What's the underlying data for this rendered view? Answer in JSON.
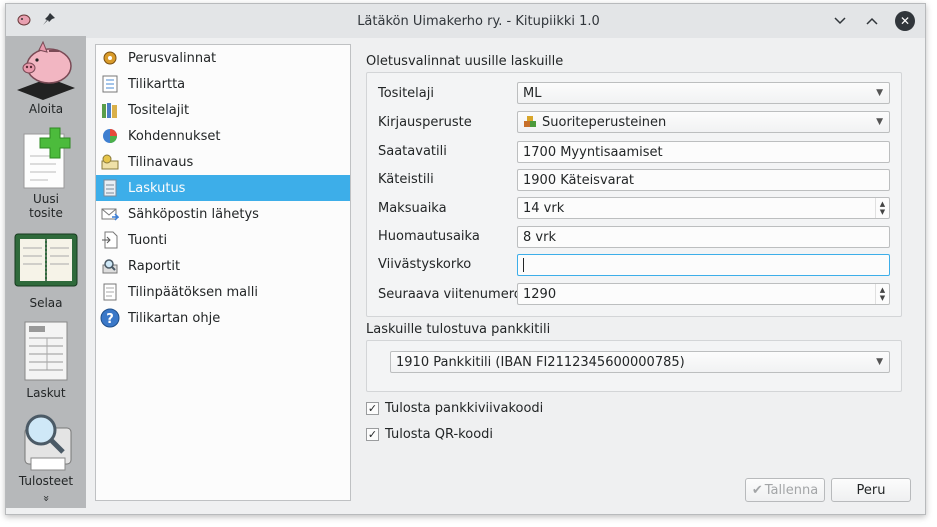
{
  "window": {
    "title": "Lätäkön Uimakerho ry. - Kitupiikki 1.0",
    "icons": [
      "app-piggy-icon",
      "pin-icon",
      "minimize-icon",
      "maximize-icon",
      "close-icon"
    ]
  },
  "toolbar": {
    "items": [
      {
        "label": "Aloita",
        "icon": "piggy-bank-icon"
      },
      {
        "label": "Uusi tosite",
        "icon": "new-document-icon"
      },
      {
        "label": "Selaa",
        "icon": "ledger-book-icon"
      },
      {
        "label": "Laskut",
        "icon": "invoice-icon"
      },
      {
        "label": "Tulosteet",
        "icon": "print-preview-icon"
      }
    ],
    "more": "»"
  },
  "nav": {
    "items": [
      {
        "label": "Perusvalinnat",
        "icon": "settings-icon"
      },
      {
        "label": "Tilikartta",
        "icon": "chart-of-accounts-icon"
      },
      {
        "label": "Tositelajit",
        "icon": "binders-icon"
      },
      {
        "label": "Kohdennukset",
        "icon": "pie-chart-icon"
      },
      {
        "label": "Tilinavaus",
        "icon": "coins-icon"
      },
      {
        "label": "Laskutus",
        "icon": "invoice-icon"
      },
      {
        "label": "Sähköpostin lähetys",
        "icon": "email-send-icon"
      },
      {
        "label": "Tuonti",
        "icon": "import-icon"
      },
      {
        "label": "Raportit",
        "icon": "report-icon"
      },
      {
        "label": "Tilinpäätöksen malli",
        "icon": "template-icon"
      },
      {
        "label": "Tilikartan ohje",
        "icon": "help-icon"
      }
    ],
    "selected": "Laskutus"
  },
  "defaults": {
    "title": "Oletusvalinnat uusille laskuille",
    "tositelaji": {
      "label": "Tositelaji",
      "value": "ML"
    },
    "kirjausperuste": {
      "label": "Kirjausperuste",
      "value": "Suoriteperusteinen"
    },
    "saatavatili": {
      "label": "Saatavatili",
      "value": "1700 Myyntisaamiset"
    },
    "kateistili": {
      "label": "Käteistili",
      "value": "1900 Käteisvarat"
    },
    "maksuaika": {
      "label": "Maksuaika",
      "value": "14 vrk"
    },
    "huomautusaika": {
      "label": "Huomautusaika",
      "value": "8 vrk"
    },
    "viivastyskorko": {
      "label": "Viivästyskorko",
      "value": ""
    },
    "viitenumero": {
      "label": "Seuraava viitenumero",
      "value": "1290"
    }
  },
  "bank": {
    "title": "Laskuille tulostuva pankkitili",
    "value": "1910 Pankkitili (IBAN FI2112345600000785)"
  },
  "options": {
    "pankkiviivakoodi": {
      "label": "Tulosta pankkiviivakoodi",
      "checked": true
    },
    "qrkoodi": {
      "label": "Tulosta QR-koodi",
      "checked": true
    }
  },
  "buttons": {
    "save": "Tallenna",
    "cancel": "Peru"
  },
  "colors": {
    "selection": "#3daee9",
    "toolbar_bg": "#b6b8ba",
    "window_bg": "#eff0f1"
  }
}
